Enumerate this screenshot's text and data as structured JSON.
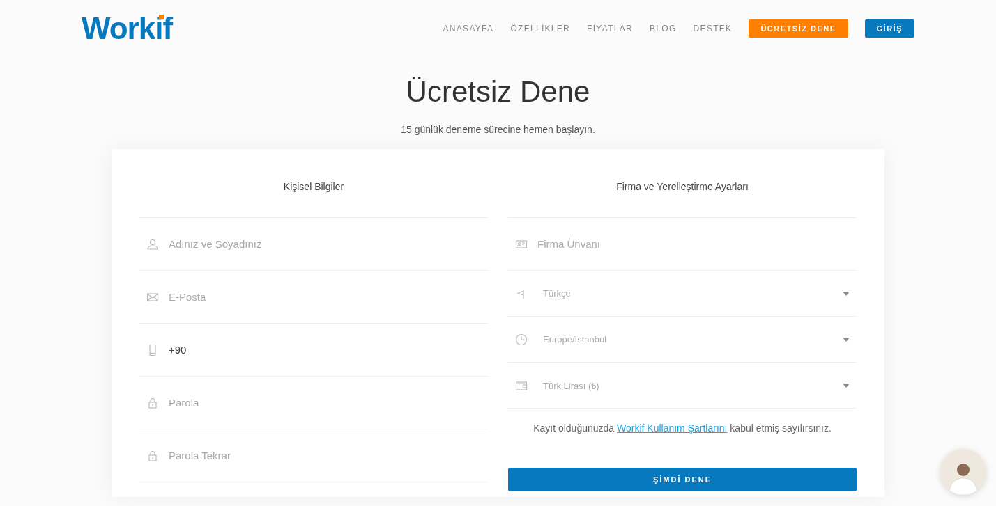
{
  "logo": "Workif",
  "nav": [
    {
      "label": "ANASAYFA",
      "kind": "link"
    },
    {
      "label": "ÖZELLİKLER",
      "kind": "link"
    },
    {
      "label": "FİYATLAR",
      "kind": "link"
    },
    {
      "label": "BLOG",
      "kind": "link"
    },
    {
      "label": "DESTEK",
      "kind": "link"
    },
    {
      "label": "ÜCRETSİZ DENE",
      "kind": "primary"
    },
    {
      "label": "GİRİŞ",
      "kind": "secondary"
    }
  ],
  "title": "Ücretsiz Dene",
  "subtitle": "15 günlük deneme sürecine hemen başlayın.",
  "personal": {
    "heading": "Kişisel Bilgiler",
    "fields": [
      {
        "kind": "user",
        "placeholder": "Adınız ve Soyadınız"
      },
      {
        "kind": "mail",
        "placeholder": "E-Posta"
      },
      {
        "kind": "phone",
        "value": "+90"
      },
      {
        "kind": "lock",
        "placeholder": "Parola"
      },
      {
        "kind": "lock",
        "placeholder": "Parola Tekrar"
      }
    ]
  },
  "company": {
    "heading": "Firma ve Yerelleştirme Ayarları",
    "fields": [
      {
        "kind": "card",
        "dropdown": false,
        "placeholder": "Firma Ünvanı"
      },
      {
        "kind": "flag",
        "dropdown": true,
        "value": "Türkçe"
      },
      {
        "kind": "clock",
        "dropdown": true,
        "value": "Europe/Istanbul"
      },
      {
        "kind": "wallet",
        "dropdown": true,
        "value": "Türk Lirası (₺)"
      }
    ]
  },
  "terms": {
    "before": "Kayıt olduğunuzda",
    "link": "Workif Kullanım Şartlarını",
    "after": "kabul etmiş sayılırsınız."
  },
  "submit": "ŞİMDİ DENE"
}
